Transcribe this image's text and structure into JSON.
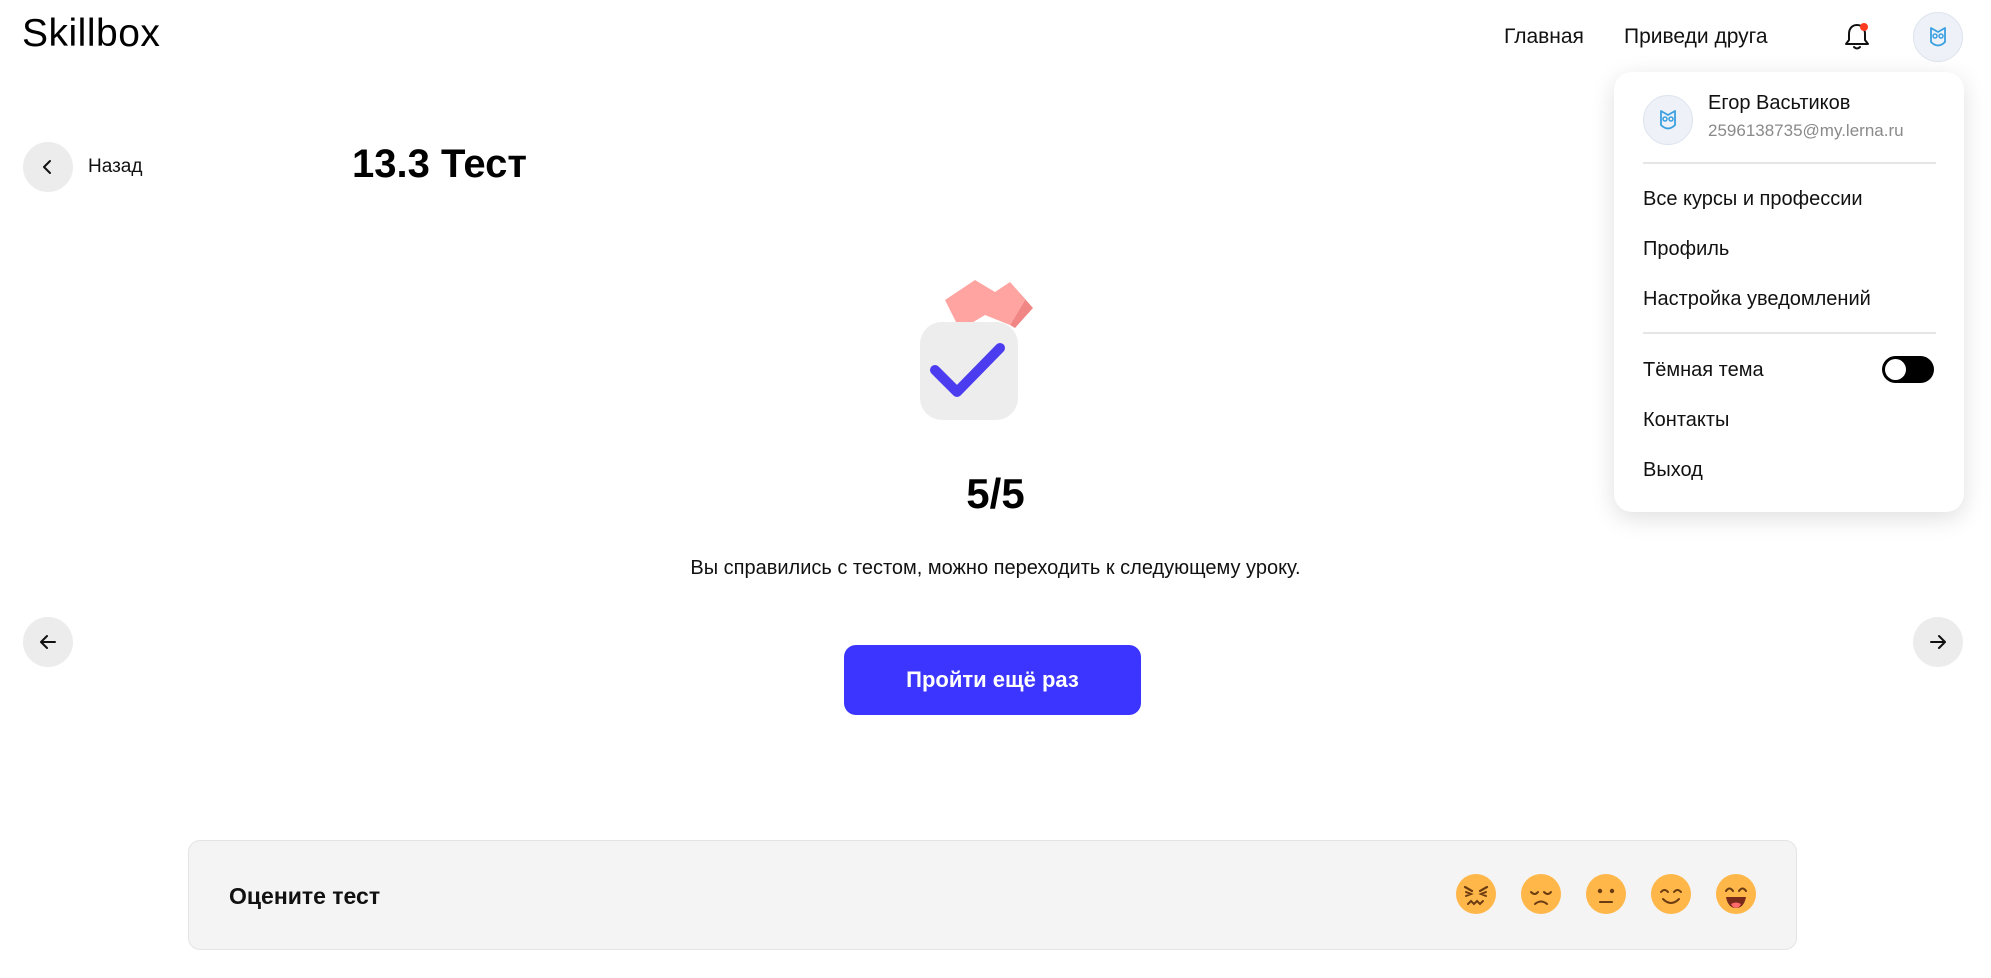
{
  "header": {
    "logo": "Skillbox",
    "nav": [
      "Главная",
      "Приведи друга"
    ],
    "has_notification": true
  },
  "back": {
    "label": "Назад"
  },
  "lesson": {
    "title": "13.3 Тест"
  },
  "result": {
    "score": "5/5",
    "message": "Вы справились с тестом, можно переходить к следующему уроку.",
    "retry_label": "Пройти ещё раз"
  },
  "rating": {
    "title": "Оцените тест",
    "emojis": [
      "angry-face-icon",
      "sad-face-icon",
      "neutral-face-icon",
      "smiling-face-icon",
      "grinning-face-icon"
    ]
  },
  "user_menu": {
    "name": "Егор Васьтиков",
    "email": "2596138735@my.lerna.ru",
    "items_top": [
      "Все курсы и профессии",
      "Профиль",
      "Настройка уведомлений"
    ],
    "dark_theme_label": "Тёмная тема",
    "dark_theme_enabled": false,
    "items_bottom": [
      "Контакты",
      "Выход"
    ]
  },
  "colors": {
    "accent": "#3b35ff",
    "notification_dot": "#ff3b1f",
    "emoji_yellow": "#ffb74a"
  }
}
